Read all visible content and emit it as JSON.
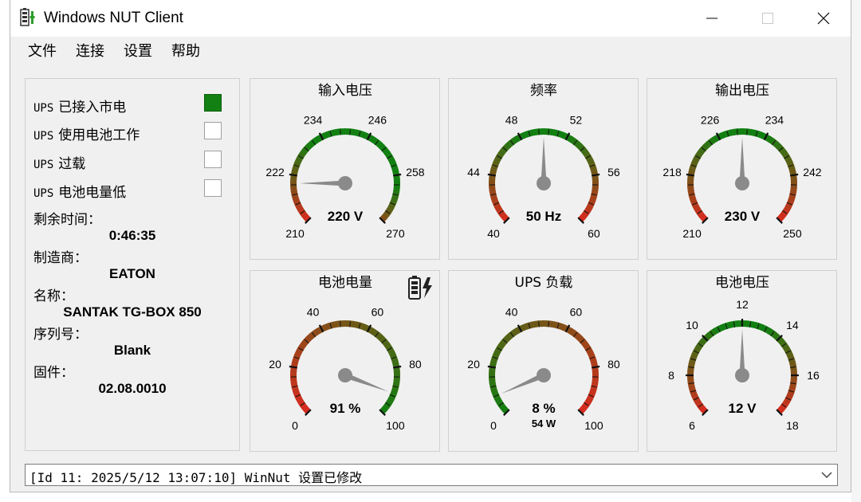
{
  "app": {
    "title": "Windows NUT Client"
  },
  "menu": {
    "items": [
      "文件",
      "连接",
      "设置",
      "帮助"
    ]
  },
  "status_flags": [
    {
      "prefix": "UPS",
      "label": "已接入市电",
      "checked": true
    },
    {
      "prefix": "UPS",
      "label": "使用电池工作",
      "checked": false
    },
    {
      "prefix": "UPS",
      "label": "过载",
      "checked": false
    },
    {
      "prefix": "UPS",
      "label": "电池电量低",
      "checked": false
    }
  ],
  "info": {
    "runtime_label": "剩余时间：",
    "runtime_value": "0:46:35",
    "manufacturer_label": "制造商：",
    "manufacturer_value": "EATON",
    "name_label": "名称：",
    "name_value": "SANTAK TG-BOX 850",
    "serial_label": "序列号：",
    "serial_value": "Blank",
    "firmware_label": "固件：",
    "firmware_value": "02.08.0010"
  },
  "gauges": [
    {
      "id": "input-voltage",
      "title": "输入电压",
      "value": 220,
      "display": "220 V",
      "sub": "",
      "min": 210,
      "max": 270,
      "labels": [
        210,
        222,
        234,
        246,
        258,
        270
      ],
      "gradient": "rgg"
    },
    {
      "id": "frequency",
      "title": "频率",
      "value": 50,
      "display": "50 Hz",
      "sub": "",
      "min": 40,
      "max": 60,
      "labels": [
        40,
        44,
        48,
        52,
        56,
        60
      ],
      "gradient": "rgr"
    },
    {
      "id": "output-voltage",
      "title": "输出电压",
      "value": 230,
      "display": "230 V",
      "sub": "",
      "min": 210,
      "max": 250,
      "labels": [
        210,
        218,
        226,
        234,
        242,
        250
      ],
      "gradient": "rgr"
    },
    {
      "id": "battery-charge",
      "title": "电池电量",
      "value": 91,
      "display": "91 %",
      "sub": "",
      "min": 0,
      "max": 100,
      "labels": [
        0,
        20,
        40,
        60,
        80,
        100
      ],
      "gradient": "rg",
      "battery_icon": true
    },
    {
      "id": "ups-load",
      "title": "UPS 负载",
      "value": 8,
      "display": "8 %",
      "sub": "54 W",
      "min": 0,
      "max": 100,
      "labels": [
        0,
        20,
        40,
        60,
        80,
        100
      ],
      "gradient": "gr"
    },
    {
      "id": "battery-voltage",
      "title": "电池电压",
      "value": 12,
      "display": "12 V",
      "sub": "",
      "min": 6,
      "max": 18,
      "labels": [
        6,
        8,
        10,
        12,
        14,
        16,
        18
      ],
      "gradient": "rgr"
    }
  ],
  "log": {
    "text": "[Id 11: 2025/5/12 13:07:10] WinNut 设置已修改"
  },
  "colors": {
    "green": "#128012",
    "red": "#d92b1f",
    "needle": "#8a8a8a"
  }
}
